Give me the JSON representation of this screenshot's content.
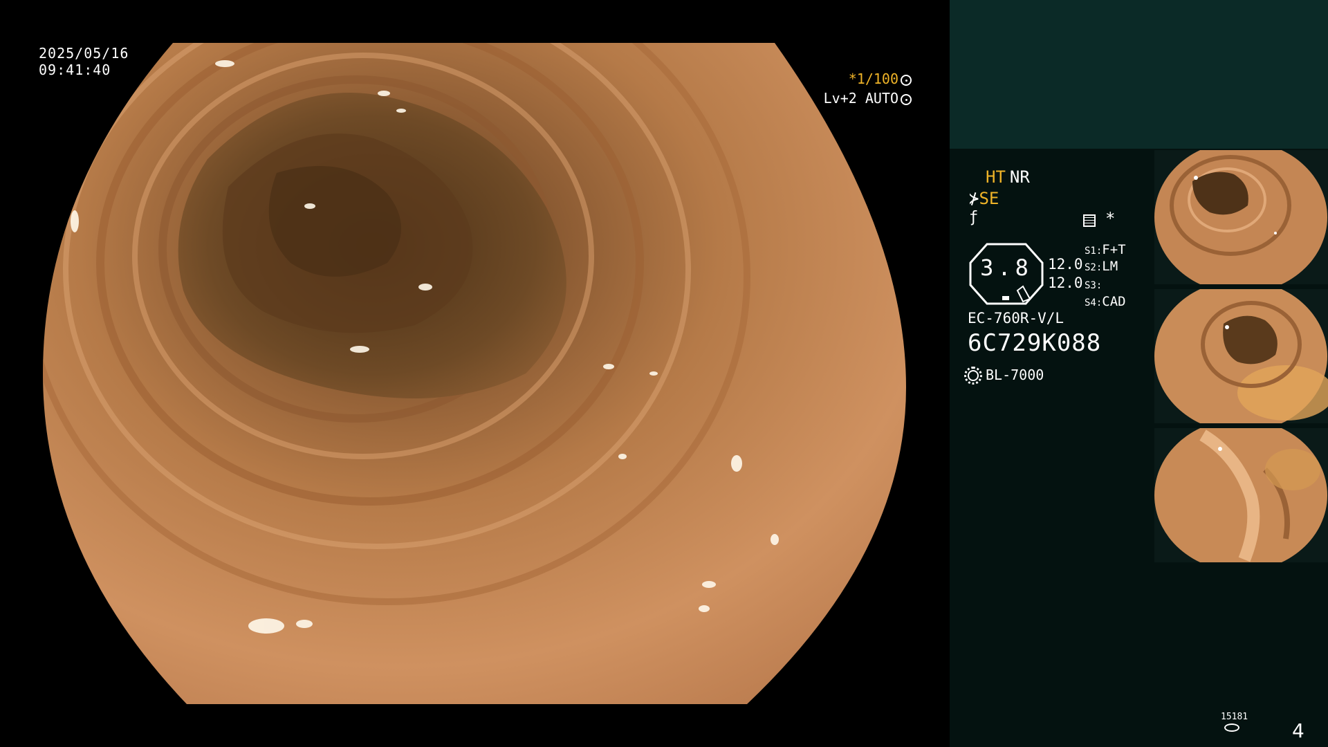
{
  "main_view": {
    "date": "2025/05/16",
    "time": "09:41:40",
    "shutter": "*1/100",
    "level": "Lv+2 AUTO"
  },
  "settings": {
    "ht": "HT",
    "nr": "NR",
    "se": "SE",
    "iris_value": "3.8",
    "value_a": "12.0",
    "value_b": "12.0",
    "s1_tag": "S1:",
    "s1_value": "F+T",
    "s2_tag": "S2:",
    "s2_value": "LM",
    "s3_tag": "S3:",
    "s3_value": "",
    "s4_tag": "S4:",
    "s4_value": "CAD",
    "scope_model": "EC-760R-V/L",
    "scope_serial": "6C729K088",
    "light_source": "BL-7000"
  },
  "footer": {
    "counter": "15181",
    "page": "4"
  },
  "colors": {
    "accent_orange": "#f0b428",
    "panel_bg": "#041210",
    "panel_header_bg": "#0b2a27",
    "mucosa": "#c98a55"
  },
  "icons": [
    "dial-icon",
    "se-icon",
    "filter-icon",
    "grid-icon",
    "star-icon",
    "sun-icon",
    "disk-icon"
  ]
}
